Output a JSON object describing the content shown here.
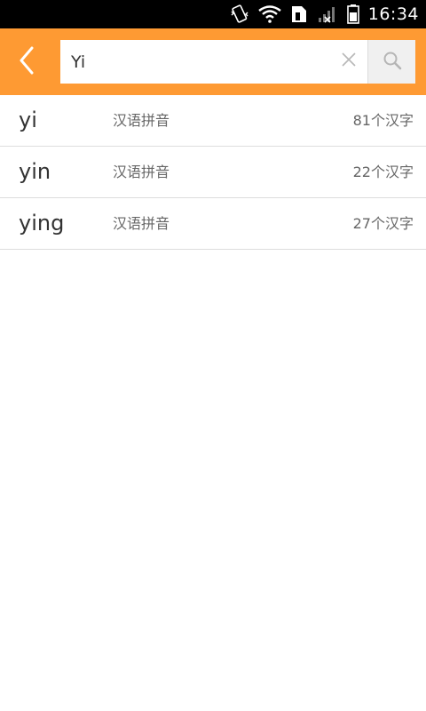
{
  "status_bar": {
    "time": "16:34",
    "icons": [
      "vibrate-icon",
      "wifi-icon",
      "sim-card-icon",
      "signal-no-service-icon",
      "battery-icon"
    ]
  },
  "colors": {
    "accent": "#fe9a33",
    "search_button_bg": "#f0f0f0",
    "divider": "#dddddd"
  },
  "header": {
    "back_icon": "chevron-left-icon",
    "search": {
      "value": "Yi",
      "clear_icon": "close-icon",
      "search_icon": "search-icon"
    }
  },
  "results": [
    {
      "pinyin": "yi",
      "type": "汉语拼音",
      "count": "81个汉字"
    },
    {
      "pinyin": "yin",
      "type": "汉语拼音",
      "count": "22个汉字"
    },
    {
      "pinyin": "ying",
      "type": "汉语拼音",
      "count": "27个汉字"
    }
  ]
}
